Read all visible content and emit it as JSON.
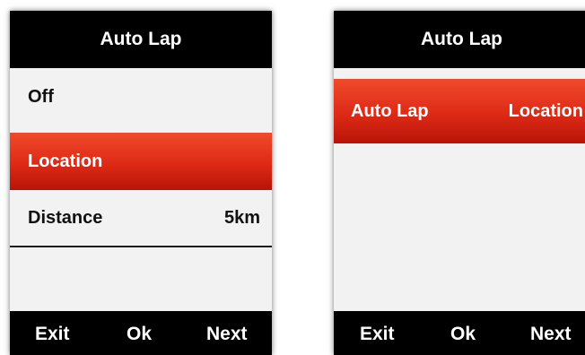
{
  "left_screen": {
    "title": "Auto Lap",
    "items": [
      {
        "label": "Off",
        "value": ""
      },
      {
        "label": "Location",
        "value": "",
        "selected": true
      },
      {
        "label": "Distance",
        "value": "5km"
      }
    ],
    "softkeys": {
      "exit": "Exit",
      "ok": "Ok",
      "next": "Next"
    }
  },
  "right_screen": {
    "title": "Auto Lap",
    "item": {
      "label": "Auto Lap",
      "value": "Location",
      "selected": true
    },
    "softkeys": {
      "exit": "Exit",
      "ok": "Ok",
      "next": "Next"
    }
  },
  "colors": {
    "selection": "#dd2a16",
    "bar_background": "#000000",
    "screen_background": "#f2f2f2"
  }
}
